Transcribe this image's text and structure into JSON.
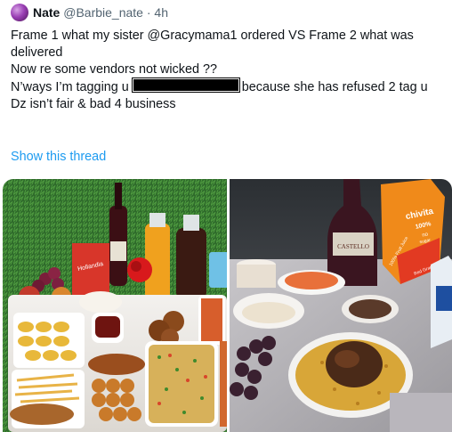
{
  "tweet": {
    "author_name": "Nate",
    "author_handle": "@Barbie_nate",
    "separator": "·",
    "time": "4h",
    "lines": [
      "Frame 1 what my sister @Gracymama1 ordered VS Frame 2 what was",
      "delivered",
      "Now re some vendors not wicked ??",
      "N’ways I’m tagging u",
      "because she has refused 2 tag u",
      "Dz isn’t fair & bad 4 business"
    ],
    "show_thread": "Show this thread"
  },
  "media": {
    "frame2_labels": {
      "juice_brand": "chivita",
      "juice_pct": "100%",
      "juice_no": "no",
      "juice_sugar": "sugar",
      "juice_side": "100% Fruit Juice",
      "juice_flavor": "Red Grape",
      "wine_label": "CASTELLO"
    },
    "frame1_labels": {
      "juice_box": "Hollandia"
    }
  },
  "colors": {
    "link": "#1d9bf0",
    "secondary_text": "#536471"
  }
}
